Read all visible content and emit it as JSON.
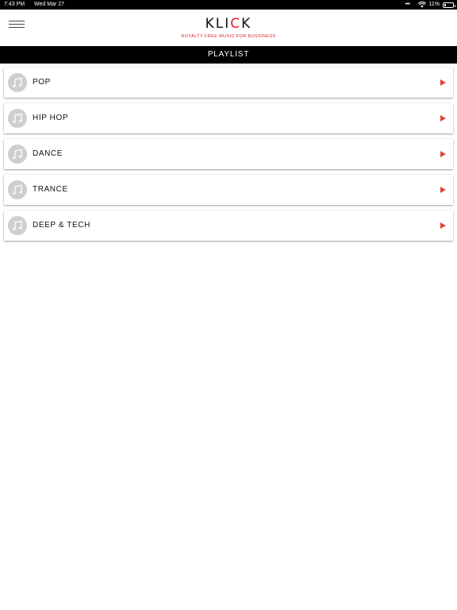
{
  "status_bar": {
    "time": "7:43 PM",
    "date": "Wed Mar 27",
    "battery": "11%",
    "dots": "•••"
  },
  "header": {
    "logo_part1": "KLI",
    "logo_accent": "C",
    "logo_part2": "K",
    "tagline": "ROYALTY FREE MUSIC FOR BUSSINESS"
  },
  "title_bar": {
    "title": "PLAYLIST"
  },
  "playlists": [
    {
      "label": "POP",
      "icon": "music-note-icon"
    },
    {
      "label": "HIP HOP",
      "icon": "music-note-icon"
    },
    {
      "label": "DANCE",
      "icon": "music-note-icon"
    },
    {
      "label": "TRANCE",
      "icon": "music-note-icon"
    },
    {
      "label": "DEEP & TECH",
      "icon": "music-note-icon"
    }
  ],
  "colors": {
    "accent": "#e02020",
    "arrow": "#e0453a",
    "bar": "#000000"
  }
}
